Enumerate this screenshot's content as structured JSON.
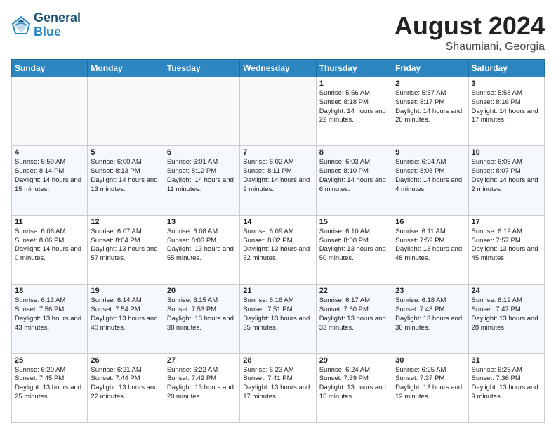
{
  "header": {
    "logo_line1": "General",
    "logo_line2": "Blue",
    "month": "August 2024",
    "location": "Shaumiani, Georgia"
  },
  "weekdays": [
    "Sunday",
    "Monday",
    "Tuesday",
    "Wednesday",
    "Thursday",
    "Friday",
    "Saturday"
  ],
  "weeks": [
    [
      {
        "day": "",
        "text": ""
      },
      {
        "day": "",
        "text": ""
      },
      {
        "day": "",
        "text": ""
      },
      {
        "day": "",
        "text": ""
      },
      {
        "day": "1",
        "text": "Sunrise: 5:56 AM\nSunset: 8:18 PM\nDaylight: 14 hours\nand 22 minutes."
      },
      {
        "day": "2",
        "text": "Sunrise: 5:57 AM\nSunset: 8:17 PM\nDaylight: 14 hours\nand 20 minutes."
      },
      {
        "day": "3",
        "text": "Sunrise: 5:58 AM\nSunset: 8:16 PM\nDaylight: 14 hours\nand 17 minutes."
      }
    ],
    [
      {
        "day": "4",
        "text": "Sunrise: 5:59 AM\nSunset: 8:14 PM\nDaylight: 14 hours\nand 15 minutes."
      },
      {
        "day": "5",
        "text": "Sunrise: 6:00 AM\nSunset: 8:13 PM\nDaylight: 14 hours\nand 13 minutes."
      },
      {
        "day": "6",
        "text": "Sunrise: 6:01 AM\nSunset: 8:12 PM\nDaylight: 14 hours\nand 11 minutes."
      },
      {
        "day": "7",
        "text": "Sunrise: 6:02 AM\nSunset: 8:11 PM\nDaylight: 14 hours\nand 9 minutes."
      },
      {
        "day": "8",
        "text": "Sunrise: 6:03 AM\nSunset: 8:10 PM\nDaylight: 14 hours\nand 6 minutes."
      },
      {
        "day": "9",
        "text": "Sunrise: 6:04 AM\nSunset: 8:08 PM\nDaylight: 14 hours\nand 4 minutes."
      },
      {
        "day": "10",
        "text": "Sunrise: 6:05 AM\nSunset: 8:07 PM\nDaylight: 14 hours\nand 2 minutes."
      }
    ],
    [
      {
        "day": "11",
        "text": "Sunrise: 6:06 AM\nSunset: 8:06 PM\nDaylight: 14 hours\nand 0 minutes."
      },
      {
        "day": "12",
        "text": "Sunrise: 6:07 AM\nSunset: 8:04 PM\nDaylight: 13 hours\nand 57 minutes."
      },
      {
        "day": "13",
        "text": "Sunrise: 6:08 AM\nSunset: 8:03 PM\nDaylight: 13 hours\nand 55 minutes."
      },
      {
        "day": "14",
        "text": "Sunrise: 6:09 AM\nSunset: 8:02 PM\nDaylight: 13 hours\nand 52 minutes."
      },
      {
        "day": "15",
        "text": "Sunrise: 6:10 AM\nSunset: 8:00 PM\nDaylight: 13 hours\nand 50 minutes."
      },
      {
        "day": "16",
        "text": "Sunrise: 6:11 AM\nSunset: 7:59 PM\nDaylight: 13 hours\nand 48 minutes."
      },
      {
        "day": "17",
        "text": "Sunrise: 6:12 AM\nSunset: 7:57 PM\nDaylight: 13 hours\nand 45 minutes."
      }
    ],
    [
      {
        "day": "18",
        "text": "Sunrise: 6:13 AM\nSunset: 7:56 PM\nDaylight: 13 hours\nand 43 minutes."
      },
      {
        "day": "19",
        "text": "Sunrise: 6:14 AM\nSunset: 7:54 PM\nDaylight: 13 hours\nand 40 minutes."
      },
      {
        "day": "20",
        "text": "Sunrise: 6:15 AM\nSunset: 7:53 PM\nDaylight: 13 hours\nand 38 minutes."
      },
      {
        "day": "21",
        "text": "Sunrise: 6:16 AM\nSunset: 7:51 PM\nDaylight: 13 hours\nand 35 minutes."
      },
      {
        "day": "22",
        "text": "Sunrise: 6:17 AM\nSunset: 7:50 PM\nDaylight: 13 hours\nand 33 minutes."
      },
      {
        "day": "23",
        "text": "Sunrise: 6:18 AM\nSunset: 7:48 PM\nDaylight: 13 hours\nand 30 minutes."
      },
      {
        "day": "24",
        "text": "Sunrise: 6:19 AM\nSunset: 7:47 PM\nDaylight: 13 hours\nand 28 minutes."
      }
    ],
    [
      {
        "day": "25",
        "text": "Sunrise: 6:20 AM\nSunset: 7:45 PM\nDaylight: 13 hours\nand 25 minutes."
      },
      {
        "day": "26",
        "text": "Sunrise: 6:21 AM\nSunset: 7:44 PM\nDaylight: 13 hours\nand 22 minutes."
      },
      {
        "day": "27",
        "text": "Sunrise: 6:22 AM\nSunset: 7:42 PM\nDaylight: 13 hours\nand 20 minutes."
      },
      {
        "day": "28",
        "text": "Sunrise: 6:23 AM\nSunset: 7:41 PM\nDaylight: 13 hours\nand 17 minutes."
      },
      {
        "day": "29",
        "text": "Sunrise: 6:24 AM\nSunset: 7:39 PM\nDaylight: 13 hours\nand 15 minutes."
      },
      {
        "day": "30",
        "text": "Sunrise: 6:25 AM\nSunset: 7:37 PM\nDaylight: 13 hours\nand 12 minutes."
      },
      {
        "day": "31",
        "text": "Sunrise: 6:26 AM\nSunset: 7:36 PM\nDaylight: 13 hours\nand 9 minutes."
      }
    ]
  ]
}
